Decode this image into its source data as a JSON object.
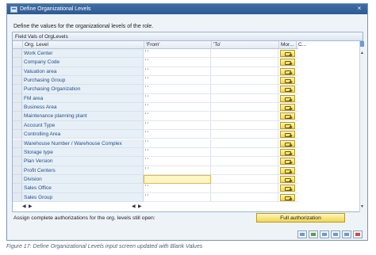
{
  "window": {
    "title": "Define Organizational Levels",
    "close_glyph": "×",
    "description": "Define the values for the organizational levels of the role."
  },
  "panel": {
    "title": "Field Vals of OrgLevels",
    "columns": [
      "Org. Level",
      "'From'",
      "'To'",
      "Mor...",
      "C..."
    ]
  },
  "rows": [
    {
      "level": "Work Center",
      "from": "' '",
      "to": ""
    },
    {
      "level": "Company Code",
      "from": "' '",
      "to": ""
    },
    {
      "level": "Valuation area",
      "from": "' '",
      "to": ""
    },
    {
      "level": "Purchasing Group",
      "from": "' '",
      "to": ""
    },
    {
      "level": "Purchasing Organization",
      "from": "' '",
      "to": ""
    },
    {
      "level": "FM area",
      "from": "' '",
      "to": ""
    },
    {
      "level": "Business Area",
      "from": "' '",
      "to": ""
    },
    {
      "level": "Maintenance planning plant",
      "from": "' '",
      "to": ""
    },
    {
      "level": "Account Type",
      "from": "' '",
      "to": ""
    },
    {
      "level": "Controlling Area",
      "from": "' '",
      "to": ""
    },
    {
      "level": "Warehouse Number / Warehouse Complex",
      "from": "' '",
      "to": ""
    },
    {
      "level": "Storage type",
      "from": "' '",
      "to": ""
    },
    {
      "level": "Plan Version",
      "from": "' '",
      "to": ""
    },
    {
      "level": "Profit Centers",
      "from": "' '",
      "to": ""
    },
    {
      "level": "Division",
      "from": "",
      "to": ""
    },
    {
      "level": "Sales Office",
      "from": "' '",
      "to": ""
    },
    {
      "level": "Sales Group",
      "from": "' '",
      "to": ""
    }
  ],
  "footer": {
    "assign_label": "Assign complete authorizations for the org. levels still open:",
    "full_auth_button": "Full authorization"
  },
  "caption": "Figure 17: Define Organizational Levels input screen updated with Blank Values"
}
